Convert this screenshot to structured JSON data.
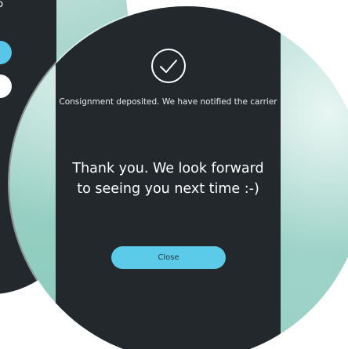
{
  "back_screen": {
    "partial_text": "to"
  },
  "dialog": {
    "status_message": "Consignment deposited. We have notified the carrier",
    "thank_you_message": "Thank you. We look forward to seeing you next time :-)",
    "close_label": "Close",
    "icon": "checkmark-circle-icon"
  },
  "colors": {
    "panel": "#23282c",
    "accent": "#5ccbea",
    "text": "#ffffff"
  }
}
